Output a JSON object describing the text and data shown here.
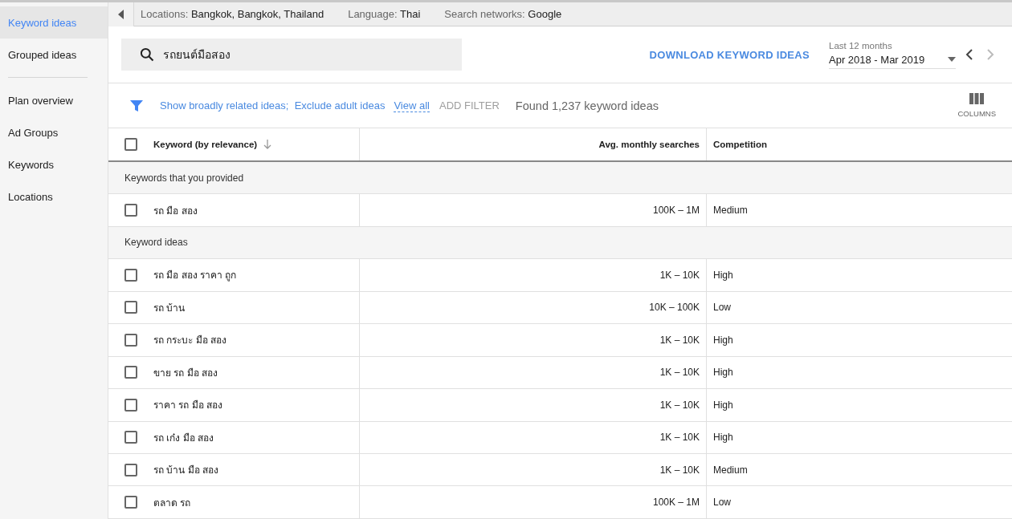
{
  "sidebar": {
    "primary_items": [
      {
        "label": "Keyword ideas",
        "selected": true
      },
      {
        "label": "Grouped ideas",
        "selected": false
      }
    ],
    "secondary_items": [
      {
        "label": "Plan overview",
        "selected": false
      },
      {
        "label": "Ad Groups",
        "selected": false
      },
      {
        "label": "Keywords",
        "selected": false
      },
      {
        "label": "Locations",
        "selected": false
      }
    ]
  },
  "targeting_bar": [
    {
      "label": "Locations:",
      "value": "Bangkok, Bangkok, Thailand"
    },
    {
      "label": "Language:",
      "value": "Thai"
    },
    {
      "label": "Search networks:",
      "value": "Google"
    }
  ],
  "search": {
    "value": "รถยนต์มือสอง"
  },
  "download_button": "DOWNLOAD KEYWORD IDEAS",
  "date_range": {
    "label": "Last 12 months",
    "value": "Apr 2018 - Mar 2019",
    "next_disabled": true
  },
  "filters": {
    "applied": "Show broadly related ideas;  Exclude adult ideas",
    "view_all": "View all",
    "add_filter": "ADD FILTER",
    "result_count": "Found 1,237 keyword ideas",
    "columns_button": "COLUMNS"
  },
  "table": {
    "columns": [
      "Keyword (by relevance)",
      "Avg. monthly searches",
      "Competition"
    ],
    "select_all_checked": false,
    "rows": [
      {
        "kind": "section",
        "label": "Keywords that you provided"
      },
      {
        "kind": "keyword",
        "keyword": "รถ มือ สอง",
        "searches": "100K – 1M",
        "competition": "Medium",
        "checked": false
      },
      {
        "kind": "section",
        "label": "Keyword ideas"
      },
      {
        "kind": "keyword",
        "keyword": "รถ มือ สอง ราคา ถูก",
        "searches": "1K – 10K",
        "competition": "High",
        "checked": false
      },
      {
        "kind": "keyword",
        "keyword": "รถ บ้าน",
        "searches": "10K – 100K",
        "competition": "Low",
        "checked": false
      },
      {
        "kind": "keyword",
        "keyword": "รถ กระบะ มือ สอง",
        "searches": "1K – 10K",
        "competition": "High",
        "checked": false
      },
      {
        "kind": "keyword",
        "keyword": "ขาย รถ มือ สอง",
        "searches": "1K – 10K",
        "competition": "High",
        "checked": false
      },
      {
        "kind": "keyword",
        "keyword": "ราคา รถ มือ สอง",
        "searches": "1K – 10K",
        "competition": "High",
        "checked": false
      },
      {
        "kind": "keyword",
        "keyword": "รถ เก๋ง มือ สอง",
        "searches": "1K – 10K",
        "competition": "High",
        "checked": false
      },
      {
        "kind": "keyword",
        "keyword": "รถ บ้าน มือ สอง",
        "searches": "1K – 10K",
        "competition": "Medium",
        "checked": false
      },
      {
        "kind": "keyword",
        "keyword": "ตลาด รถ",
        "searches": "100K – 1M",
        "competition": "Low",
        "checked": false
      }
    ]
  }
}
